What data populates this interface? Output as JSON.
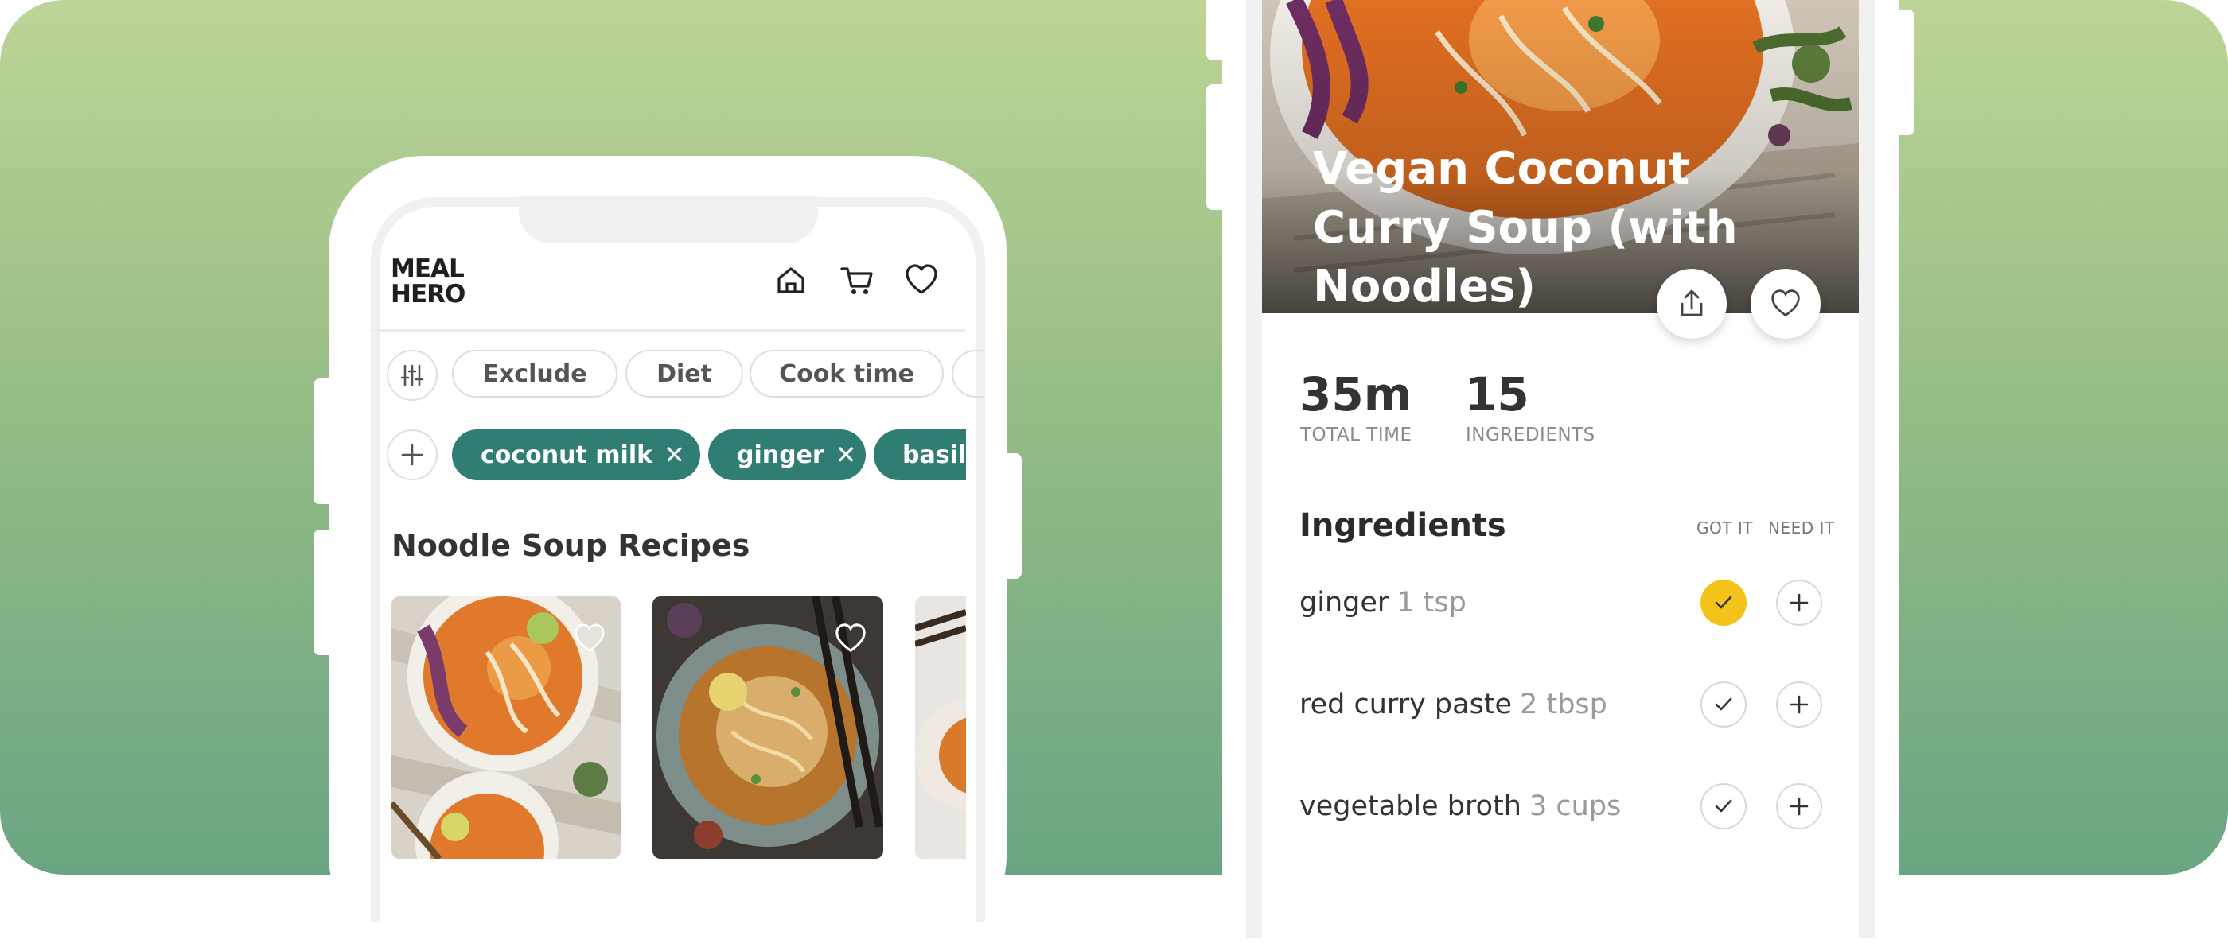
{
  "app": {
    "logo_line1": "MEAL",
    "logo_line2": "HERO"
  },
  "header_icons": [
    "home-icon",
    "cart-icon",
    "heart-icon"
  ],
  "filters": {
    "settings_icon": "sliders-icon",
    "chips": [
      "Exclude",
      "Diet",
      "Cook time"
    ]
  },
  "ingredient_tags": {
    "add_icon": "plus-icon",
    "items": [
      "coconut milk",
      "ginger",
      "basil"
    ],
    "remove_symbol": "✕"
  },
  "recipes_section": {
    "title": "Noodle Soup Recipes"
  },
  "recipe_detail": {
    "title": "Vegan Coconut Curry Soup (with Noodles)",
    "total_time_value": "35m",
    "total_time_label": "TOTAL TIME",
    "ingredients_count_value": "15",
    "ingredients_count_label": "INGREDIENTS",
    "ingredients_heading": "Ingredients",
    "col_got_it": "GOT IT",
    "col_need_it": "NEED IT",
    "ingredients": [
      {
        "name": "ginger",
        "amount": "1 tsp",
        "got_it": true
      },
      {
        "name": "red curry paste",
        "amount": "2 tbsp",
        "got_it": false
      },
      {
        "name": "vegetable broth",
        "amount": "3 cups",
        "got_it": false
      }
    ]
  },
  "colors": {
    "brand_teal": "#2f7d73",
    "checked_yellow": "#f3c31b",
    "bg_top": "#bdd596",
    "bg_bottom": "#6aa583"
  }
}
